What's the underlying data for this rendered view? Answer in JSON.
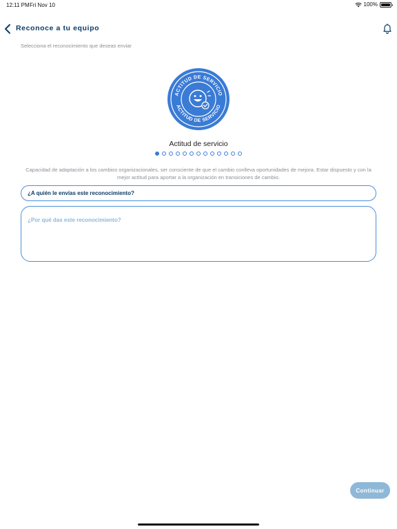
{
  "status_bar": {
    "time": "12:11 PM",
    "date": "Fri Nov 10",
    "battery_text": "100%",
    "battery_level": 1.0
  },
  "nav": {
    "title": "Reconoce a tu equipo",
    "back_icon": "chevron-left-icon",
    "bell_icon": "bell-icon"
  },
  "subtitle": "Selecciona el reconocimiento que deseas enviar",
  "badge": {
    "arc_top": "ACTITUD DE SERVICIO",
    "arc_bottom": "ACTITUD DE SERVICIO",
    "name": "Actitud de servicio",
    "color": "#3a7bd5"
  },
  "pager": {
    "count": 13,
    "active_index": 0
  },
  "description": "Capacidad de adaptación a los cambios organizacionales, ser consciente de que el cambio conlleva oportunidades de mejora. Estar dispuesto y con la mejor actitud para aportar a la organización en transiciones de cambio.",
  "form": {
    "recipient_label": "¿A quién le envías este reconocimiento?",
    "reason_placeholder": "¿Por qué das este reconocimiento?"
  },
  "continue_label": "Continuar",
  "colors": {
    "primary": "#0d3b66",
    "accent": "#3a7bd5",
    "disabled_button": "#8fb8d8"
  }
}
